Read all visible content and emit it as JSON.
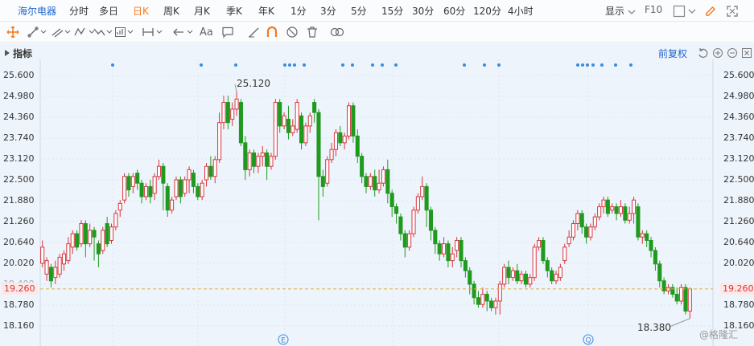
{
  "toolbar": {
    "stock_name": "海尔电器",
    "periods": [
      "分时",
      "多日",
      "日K",
      "周K",
      "月K",
      "季K",
      "年K",
      "1分",
      "3分",
      "5分",
      "15分",
      "30分",
      "60分",
      "120分",
      "4小时"
    ],
    "active_period": "日K",
    "display_label": "显示",
    "f10_label": "F10"
  },
  "draw_tools": {
    "text_tool": "Aa"
  },
  "chart": {
    "indicator_label": "指标",
    "restore_label": "前复权",
    "y_ticks": [
      "25.600",
      "24.980",
      "24.360",
      "23.740",
      "23.120",
      "22.500",
      "21.880",
      "21.260",
      "20.640",
      "20.020",
      "19.400",
      "18.780",
      "18.160"
    ],
    "current_price": "19.260",
    "high_annotation": "25.120",
    "low_annotation": "18.380",
    "event_marker_e": "E",
    "event_marker_q": "Q",
    "watermark": "@格隆汇",
    "colors": {
      "up": "#d9363e",
      "down": "#1f9a1f",
      "background": "#eef4fb",
      "current_line": "#e0b040",
      "marker": "#3a8be0"
    }
  },
  "chart_data": {
    "type": "candlestick",
    "ylim": [
      18.16,
      25.6
    ],
    "current_price": 19.26,
    "high": 25.12,
    "low": 18.38,
    "candles": [
      [
        20.02,
        20.5,
        20.7,
        19.9
      ],
      [
        19.7,
        20.1,
        20.2,
        19.5
      ],
      [
        19.9,
        19.5,
        20.0,
        19.3
      ],
      [
        19.6,
        19.9,
        20.1,
        19.4
      ],
      [
        19.7,
        20.2,
        20.3,
        19.6
      ],
      [
        20.0,
        20.3,
        20.4,
        19.8
      ],
      [
        20.1,
        20.6,
        20.8,
        20.0
      ],
      [
        20.5,
        20.9,
        21.0,
        20.3
      ],
      [
        20.9,
        20.5,
        21.0,
        20.4
      ],
      [
        20.6,
        21.2,
        21.3,
        20.5
      ],
      [
        21.2,
        20.6,
        21.3,
        20.2
      ],
      [
        20.6,
        21.0,
        21.2,
        20.5
      ],
      [
        21.0,
        20.8,
        21.1,
        20.1
      ],
      [
        20.6,
        20.3,
        20.7,
        19.9
      ],
      [
        20.4,
        21.0,
        21.1,
        20.3
      ],
      [
        21.2,
        20.6,
        21.4,
        20.5
      ],
      [
        20.7,
        21.1,
        21.2,
        20.6
      ],
      [
        21.1,
        21.5,
        21.6,
        21.0
      ],
      [
        21.6,
        21.8,
        21.9,
        21.4
      ],
      [
        21.9,
        22.6,
        22.7,
        21.8
      ],
      [
        22.6,
        22.2,
        22.7,
        22.0
      ],
      [
        22.3,
        22.6,
        22.7,
        22.1
      ],
      [
        22.7,
        22.4,
        22.8,
        22.2
      ],
      [
        22.4,
        22.0,
        22.5,
        21.8
      ],
      [
        22.0,
        22.3,
        22.4,
        21.9
      ],
      [
        22.3,
        22.0,
        22.5,
        21.8
      ],
      [
        22.1,
        22.6,
        22.7,
        21.9
      ],
      [
        22.6,
        22.9,
        23.1,
        22.5
      ],
      [
        22.9,
        22.4,
        23.0,
        21.6
      ],
      [
        22.3,
        21.6,
        22.4,
        21.4
      ],
      [
        21.6,
        21.9,
        22.0,
        21.5
      ],
      [
        22.0,
        22.5,
        22.6,
        21.9
      ],
      [
        22.5,
        22.0,
        22.6,
        21.8
      ],
      [
        22.1,
        22.5,
        22.6,
        22.0
      ],
      [
        22.5,
        22.8,
        22.9,
        22.1
      ],
      [
        22.7,
        22.3,
        22.8,
        22.1
      ],
      [
        22.3,
        22.0,
        22.4,
        21.9
      ],
      [
        22.0,
        22.4,
        22.5,
        21.9
      ],
      [
        22.5,
        22.9,
        23.0,
        22.3
      ],
      [
        22.9,
        22.6,
        23.2,
        22.5
      ],
      [
        22.6,
        23.1,
        23.2,
        22.4
      ],
      [
        23.1,
        24.2,
        24.5,
        23.0
      ],
      [
        24.2,
        24.8,
        25.0,
        24.0
      ],
      [
        24.8,
        24.2,
        25.0,
        24.0
      ],
      [
        24.3,
        24.6,
        24.8,
        24.1
      ],
      [
        24.6,
        24.9,
        25.12,
        24.4
      ],
      [
        24.8,
        23.6,
        24.9,
        23.5
      ],
      [
        23.6,
        22.8,
        23.8,
        22.5
      ],
      [
        22.8,
        23.3,
        23.4,
        22.6
      ],
      [
        23.3,
        22.9,
        23.4,
        22.7
      ],
      [
        22.9,
        23.2,
        23.3,
        22.7
      ],
      [
        23.2,
        23.3,
        23.5,
        22.9
      ],
      [
        23.3,
        22.9,
        23.4,
        22.5
      ],
      [
        22.9,
        23.2,
        23.3,
        22.8
      ],
      [
        23.2,
        24.8,
        24.9,
        23.1
      ],
      [
        24.8,
        24.1,
        24.9,
        23.9
      ],
      [
        24.1,
        24.4,
        24.5,
        24.0
      ],
      [
        24.3,
        23.9,
        24.7,
        23.7
      ],
      [
        23.9,
        24.1,
        24.3,
        23.8
      ],
      [
        24.0,
        24.8,
        24.9,
        23.9
      ],
      [
        24.4,
        23.6,
        24.5,
        23.4
      ],
      [
        23.6,
        24.1,
        24.2,
        23.5
      ],
      [
        24.1,
        24.4,
        24.5,
        23.9
      ],
      [
        24.8,
        24.5,
        24.9,
        24.2
      ],
      [
        24.5,
        22.6,
        24.6,
        21.3
      ],
      [
        22.6,
        22.3,
        22.8,
        22.0
      ],
      [
        22.4,
        23.1,
        23.2,
        22.3
      ],
      [
        23.1,
        23.4,
        23.6,
        23.0
      ],
      [
        23.4,
        23.9,
        24.0,
        23.2
      ],
      [
        23.9,
        23.6,
        24.1,
        23.5
      ],
      [
        23.6,
        23.8,
        23.9,
        23.4
      ],
      [
        23.8,
        24.7,
        24.8,
        23.7
      ],
      [
        24.7,
        23.8,
        24.8,
        23.6
      ],
      [
        23.8,
        23.2,
        24.0,
        23.0
      ],
      [
        23.2,
        22.6,
        23.3,
        22.4
      ],
      [
        22.6,
        22.3,
        22.7,
        22.1
      ],
      [
        22.3,
        22.6,
        22.7,
        22.2
      ],
      [
        22.6,
        22.2,
        22.8,
        22.0
      ],
      [
        22.2,
        22.4,
        22.8,
        22.1
      ],
      [
        22.4,
        22.8,
        22.9,
        22.3
      ],
      [
        22.8,
        22.1,
        23.1,
        21.8
      ],
      [
        22.1,
        21.7,
        22.2,
        21.4
      ],
      [
        21.7,
        21.5,
        21.8,
        21.2
      ],
      [
        21.4,
        20.9,
        21.5,
        20.7
      ],
      [
        20.9,
        20.5,
        21.0,
        20.2
      ],
      [
        20.5,
        20.9,
        21.0,
        20.4
      ],
      [
        20.9,
        21.6,
        21.7,
        20.8
      ],
      [
        21.6,
        22.0,
        22.1,
        21.5
      ],
      [
        22.0,
        22.3,
        22.6,
        21.9
      ],
      [
        22.3,
        21.6,
        22.4,
        21.1
      ],
      [
        21.6,
        21.0,
        21.7,
        20.7
      ],
      [
        21.0,
        20.6,
        21.1,
        20.3
      ],
      [
        20.6,
        20.3,
        20.7,
        20.1
      ],
      [
        20.3,
        20.6,
        20.8,
        20.2
      ],
      [
        20.6,
        20.1,
        20.7,
        19.9
      ],
      [
        20.1,
        20.3,
        20.5,
        19.9
      ],
      [
        20.4,
        20.7,
        20.8,
        20.2
      ],
      [
        20.7,
        20.1,
        20.8,
        19.9
      ],
      [
        20.1,
        19.8,
        20.2,
        19.6
      ],
      [
        19.8,
        19.4,
        19.9,
        19.1
      ],
      [
        19.4,
        19.0,
        19.5,
        18.8
      ],
      [
        19.0,
        18.8,
        19.2,
        18.7
      ],
      [
        18.8,
        19.1,
        19.3,
        18.7
      ],
      [
        19.1,
        18.9,
        19.2,
        18.6
      ],
      [
        18.9,
        18.7,
        19.0,
        18.6
      ],
      [
        18.7,
        18.9,
        19.0,
        18.5
      ],
      [
        18.9,
        19.4,
        19.5,
        18.5
      ],
      [
        19.4,
        19.9,
        20.0,
        19.3
      ],
      [
        19.9,
        19.6,
        20.1,
        19.4
      ],
      [
        19.6,
        19.8,
        19.9,
        19.5
      ],
      [
        19.8,
        19.5,
        20.0,
        19.4
      ],
      [
        19.5,
        19.7,
        19.8,
        19.4
      ],
      [
        19.7,
        19.4,
        19.8,
        19.3
      ],
      [
        19.4,
        19.6,
        19.7,
        19.3
      ],
      [
        19.6,
        20.5,
        20.6,
        19.5
      ],
      [
        20.5,
        20.7,
        20.8,
        20.4
      ],
      [
        20.7,
        20.1,
        20.8,
        20.0
      ],
      [
        20.1,
        19.8,
        20.2,
        19.6
      ],
      [
        19.8,
        19.5,
        19.9,
        19.4
      ],
      [
        19.5,
        19.7,
        19.8,
        19.4
      ],
      [
        19.6,
        19.9,
        20.0,
        19.5
      ],
      [
        20.1,
        20.5,
        20.6,
        20.0
      ],
      [
        20.6,
        20.8,
        21.0,
        20.5
      ],
      [
        20.8,
        21.2,
        21.3,
        20.7
      ],
      [
        21.2,
        21.5,
        21.6,
        21.0
      ],
      [
        21.5,
        21.1,
        21.6,
        20.9
      ],
      [
        21.1,
        20.8,
        21.2,
        20.6
      ],
      [
        20.8,
        21.1,
        21.2,
        20.7
      ],
      [
        21.1,
        21.4,
        21.5,
        21.0
      ],
      [
        21.4,
        21.7,
        21.8,
        21.3
      ],
      [
        21.7,
        21.9,
        22.0,
        21.5
      ],
      [
        21.9,
        21.5,
        22.0,
        21.4
      ],
      [
        21.6,
        21.7,
        21.8,
        21.5
      ],
      [
        21.7,
        21.5,
        21.8,
        21.3
      ],
      [
        21.5,
        21.7,
        21.9,
        21.4
      ],
      [
        21.7,
        21.3,
        21.8,
        21.2
      ],
      [
        21.3,
        21.5,
        21.7,
        21.2
      ],
      [
        21.5,
        21.9,
        22.0,
        21.2
      ],
      [
        21.7,
        20.8,
        21.8,
        20.7
      ],
      [
        20.8,
        20.9,
        21.0,
        20.6
      ],
      [
        20.9,
        20.7,
        21.0,
        20.5
      ],
      [
        20.7,
        20.4,
        20.8,
        20.2
      ],
      [
        20.4,
        20.0,
        20.5,
        19.8
      ],
      [
        20.0,
        19.5,
        20.1,
        19.3
      ],
      [
        19.5,
        19.2,
        19.6,
        19.1
      ],
      [
        19.2,
        19.3,
        19.4,
        19.1
      ],
      [
        19.3,
        19.1,
        19.4,
        19.0
      ],
      [
        19.1,
        18.9,
        19.3,
        18.8
      ],
      [
        18.9,
        19.3,
        19.4,
        18.8
      ],
      [
        19.3,
        18.6,
        19.4,
        18.5
      ],
      [
        18.6,
        19.26,
        19.3,
        18.38
      ]
    ],
    "event_markers_top": 20
  }
}
